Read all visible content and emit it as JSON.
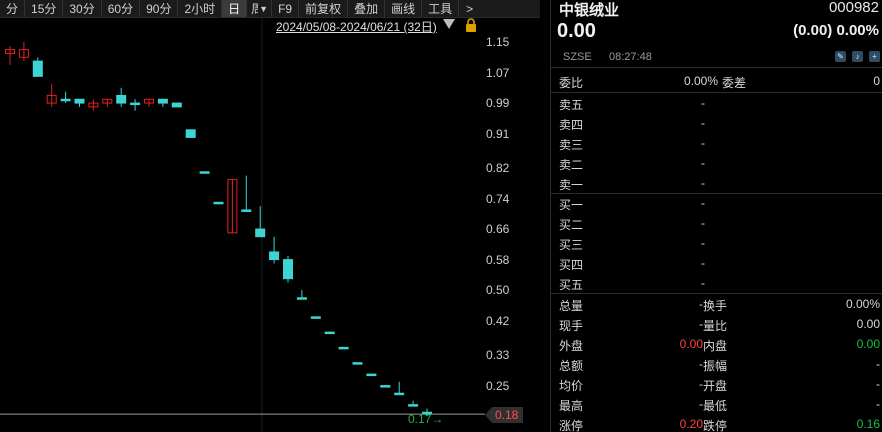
{
  "toolbar": {
    "items": [
      "分",
      "15分",
      "30分",
      "60分",
      "90分",
      "2小时",
      "日",
      "周",
      "F9",
      "前复权",
      "叠加",
      "画线",
      "工具",
      ">"
    ],
    "active": "日"
  },
  "chart": {
    "range_label": "2024/05/08-2024/06/21 (32日)",
    "last_price_tag": "0.18",
    "low_marker": "0.17",
    "colors": {
      "up": "#e02020",
      "down": "#3ed4d4",
      "background": "#000000"
    }
  },
  "chart_data": {
    "type": "candlestick",
    "y_ticks": [
      "1.15",
      "1.07",
      "0.99",
      "0.91",
      "0.82",
      "0.74",
      "0.66",
      "0.58",
      "0.50",
      "0.42",
      "0.33",
      "0.25"
    ],
    "ylim": [
      0.165,
      1.205
    ],
    "candles": [
      {
        "o": 1.12,
        "c": 1.13,
        "h": 1.14,
        "l": 1.09
      },
      {
        "o": 1.11,
        "c": 1.13,
        "h": 1.15,
        "l": 1.1
      },
      {
        "o": 1.1,
        "c": 1.06,
        "h": 1.11,
        "l": 1.06
      },
      {
        "o": 0.99,
        "c": 1.01,
        "h": 1.04,
        "l": 0.98
      },
      {
        "o": 1.0,
        "c": 1.0,
        "h": 1.02,
        "l": 0.99
      },
      {
        "o": 1.0,
        "c": 0.99,
        "h": 1.0,
        "l": 0.98
      },
      {
        "o": 0.98,
        "c": 0.99,
        "h": 1.0,
        "l": 0.97
      },
      {
        "o": 0.99,
        "c": 1.0,
        "h": 1.0,
        "l": 0.98
      },
      {
        "o": 1.01,
        "c": 0.99,
        "h": 1.03,
        "l": 0.98
      },
      {
        "o": 0.99,
        "c": 0.99,
        "h": 1.0,
        "l": 0.97
      },
      {
        "o": 0.99,
        "c": 1.0,
        "h": 1.0,
        "l": 0.98
      },
      {
        "o": 1.0,
        "c": 0.99,
        "h": 1.0,
        "l": 0.98
      },
      {
        "o": 0.99,
        "c": 0.98,
        "h": 0.99,
        "l": 0.98
      },
      {
        "o": 0.92,
        "c": 0.9,
        "h": 0.92,
        "l": 0.9
      },
      {
        "o": 0.81,
        "c": 0.81,
        "h": 0.81,
        "l": 0.81
      },
      {
        "o": 0.73,
        "c": 0.73,
        "h": 0.73,
        "l": 0.73
      },
      {
        "o": 0.65,
        "c": 0.79,
        "h": 0.79,
        "l": 0.65
      },
      {
        "o": 0.71,
        "c": 0.71,
        "h": 0.8,
        "l": 0.71
      },
      {
        "o": 0.66,
        "c": 0.64,
        "h": 0.72,
        "l": 0.64
      },
      {
        "o": 0.6,
        "c": 0.58,
        "h": 0.64,
        "l": 0.57
      },
      {
        "o": 0.58,
        "c": 0.53,
        "h": 0.59,
        "l": 0.52
      },
      {
        "o": 0.48,
        "c": 0.48,
        "h": 0.5,
        "l": 0.48
      },
      {
        "o": 0.43,
        "c": 0.43,
        "h": 0.43,
        "l": 0.43
      },
      {
        "o": 0.39,
        "c": 0.39,
        "h": 0.39,
        "l": 0.39
      },
      {
        "o": 0.35,
        "c": 0.35,
        "h": 0.35,
        "l": 0.35
      },
      {
        "o": 0.31,
        "c": 0.31,
        "h": 0.31,
        "l": 0.31
      },
      {
        "o": 0.28,
        "c": 0.28,
        "h": 0.28,
        "l": 0.28
      },
      {
        "o": 0.25,
        "c": 0.25,
        "h": 0.25,
        "l": 0.25
      },
      {
        "o": 0.23,
        "c": 0.23,
        "h": 0.26,
        "l": 0.23
      },
      {
        "o": 0.2,
        "c": 0.2,
        "h": 0.21,
        "l": 0.2
      },
      {
        "o": 0.18,
        "c": 0.18,
        "h": 0.19,
        "l": 0.17
      }
    ]
  },
  "quote": {
    "name": "中银绒业",
    "code": "000982",
    "price": "0.00",
    "change": "(0.00)",
    "change_pct": "0.00%",
    "exchange": "SZSE",
    "time": "08:27:48",
    "weibi_label": "委比",
    "weibi_value": "0.00%",
    "weicha_label": "委差",
    "weicha_value": "0",
    "asks": [
      {
        "label": "卖五",
        "value": "-"
      },
      {
        "label": "卖四",
        "value": "-"
      },
      {
        "label": "卖三",
        "value": "-"
      },
      {
        "label": "卖二",
        "value": "-"
      },
      {
        "label": "卖一",
        "value": "-"
      }
    ],
    "bids": [
      {
        "label": "买一",
        "value": "-"
      },
      {
        "label": "买二",
        "value": "-"
      },
      {
        "label": "买三",
        "value": "-"
      },
      {
        "label": "买四",
        "value": "-"
      },
      {
        "label": "买五",
        "value": "-"
      }
    ],
    "stats": [
      {
        "l1": "总量",
        "v1": "-",
        "l2": "换手",
        "v2": "0.00%"
      },
      {
        "l1": "现手",
        "v1": "-",
        "l2": "量比",
        "v2": "0.00"
      },
      {
        "l1": "外盘",
        "v1": "0.00",
        "l2": "内盘",
        "v2": "0.00"
      },
      {
        "l1": "总额",
        "v1": "-",
        "l2": "振幅",
        "v2": "-"
      },
      {
        "l1": "均价",
        "v1": "-",
        "l2": "开盘",
        "v2": "-"
      },
      {
        "l1": "最高",
        "v1": "-",
        "l2": "最低",
        "v2": "-"
      },
      {
        "l1": "涨停",
        "v1": "0.20",
        "l2": "跌停",
        "v2": "0.16"
      }
    ]
  }
}
